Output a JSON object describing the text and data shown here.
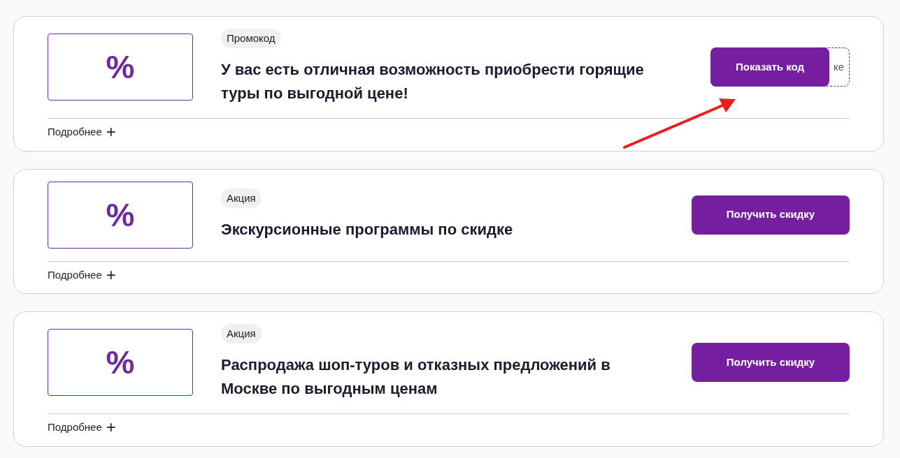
{
  "offers": [
    {
      "kind": "promo_code",
      "icon": "%",
      "badge": "Промокод",
      "title": "У вас есть отличная возможность приобрести горящие туры по выгодной цене!",
      "code_peek": "ке",
      "button": "Показать код",
      "details": "Подробнее",
      "details_icon": "+"
    },
    {
      "kind": "deal",
      "icon": "%",
      "badge": "Акция",
      "title": "Экскурсионные программы по скидке",
      "button": "Получить скидку",
      "details": "Подробнее",
      "details_icon": "+"
    },
    {
      "kind": "deal",
      "icon": "%",
      "badge": "Акция",
      "title": "Распродажа шоп-туров и отказных предложений в Москве по выгодным ценам",
      "button": "Получить скидку",
      "details": "Подробнее",
      "details_icon": "+"
    }
  ]
}
